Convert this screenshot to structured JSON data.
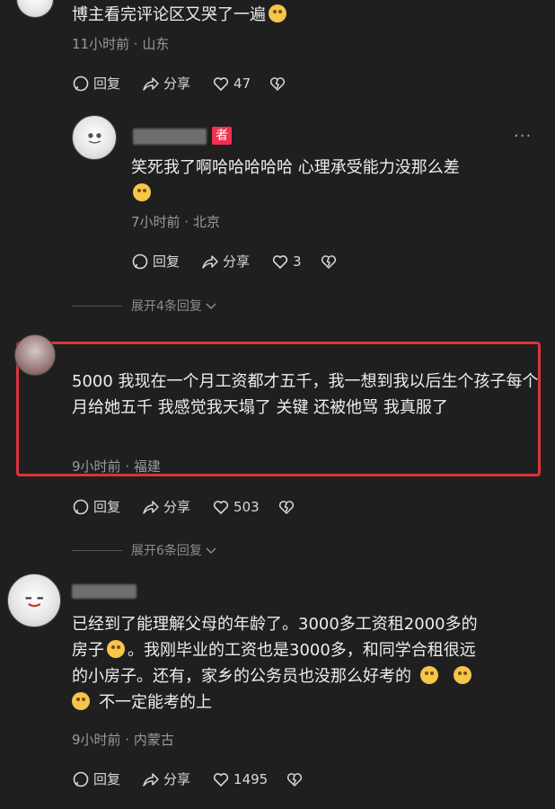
{
  "comments": [
    {
      "text": "博主看完评论区又哭了一遍",
      "meta": "11小时前 · 山东",
      "reply_label": "回复",
      "share_label": "分享",
      "likes": "47"
    },
    {
      "author_tag": "者",
      "text": "笑死我了啊哈哈哈哈哈 心理承受能力没那么差",
      "meta": "7小时前 · 北京",
      "reply_label": "回复",
      "share_label": "分享",
      "likes": "3",
      "expand_label": "展开4条回复"
    },
    {
      "text": "5000 我现在一个月工资都才五千，我一想到我以后生个孩子每个月给她五千 我感觉我天塌了 关键 还被他骂 我真服了",
      "meta": "9小时前 · 福建",
      "reply_label": "回复",
      "share_label": "分享",
      "likes": "503",
      "expand_label": "展开6条回复"
    },
    {
      "text_1": "已经到了能理解父母的年龄了。3000多工资租2000多的",
      "text_2a": "房子",
      "text_2b": "。我刚毕业的工资也是3000多，和同学合租很远",
      "text_3": "的小房子。还有，家乡的公务员也没那么好考的",
      "text_4": "不一定能考的上",
      "meta": "9小时前 · 内蒙古",
      "reply_label": "回复",
      "share_label": "分享",
      "likes": "1495"
    }
  ],
  "colors": {
    "background": "#1f1f1f",
    "highlight_border": "#d8353d",
    "author_tag": "#f0314e"
  },
  "icons": [
    "reply-icon",
    "share-icon",
    "heart-icon",
    "dislike-icon",
    "more-icon",
    "expand-chevron-icon",
    "emoji-icon"
  ]
}
